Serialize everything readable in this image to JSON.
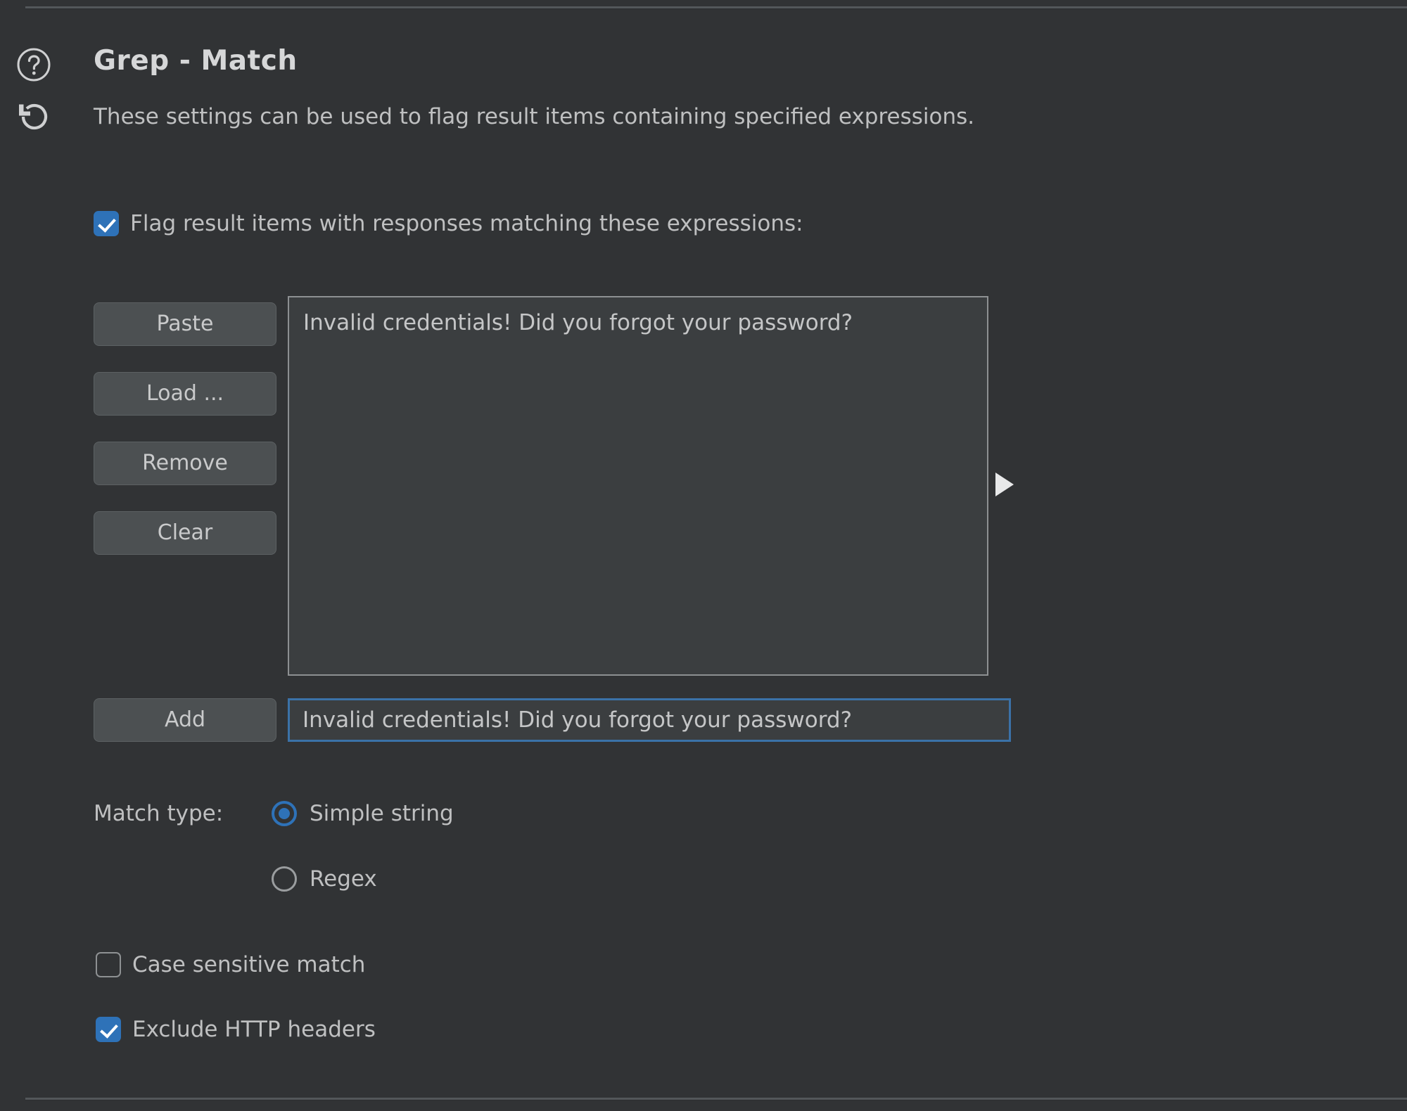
{
  "panel": {
    "title": "Grep - Match",
    "description": "These settings can be used to flag result items containing specified expressions.",
    "help_icon": "question-circle-icon",
    "reset_icon": "undo-arrow-icon",
    "accent_color": "#2e72b8",
    "background_color": "#313335",
    "text_color": "#bfc0c1"
  },
  "flag_option": {
    "label": "Flag result items with responses matching these expressions:",
    "checked": true
  },
  "buttons": {
    "paste": "Paste",
    "load": "Load ...",
    "remove": "Remove",
    "clear": "Clear",
    "add": "Add"
  },
  "expression_list": {
    "items": [
      "Invalid credentials! Did you forgot your password?"
    ]
  },
  "add_field": {
    "value": "Invalid credentials! Did you forgot your password?",
    "placeholder": ""
  },
  "match_type": {
    "label": "Match type:",
    "options": [
      {
        "label": "Simple string",
        "selected": true
      },
      {
        "label": "Regex",
        "selected": false
      }
    ]
  },
  "options": [
    {
      "label": "Case sensitive match",
      "checked": false
    },
    {
      "label": "Exclude HTTP headers",
      "checked": true
    }
  ],
  "expand_arrow_icon": "triangle-right-icon"
}
